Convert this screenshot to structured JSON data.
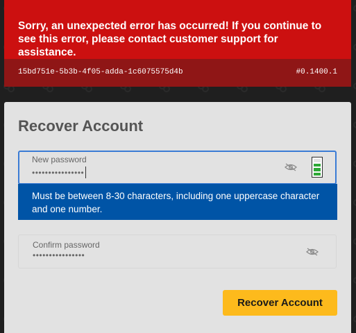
{
  "error": {
    "message": "Sorry, an unexpected error has occurred! If you continue to see this error, please contact customer support for assistance.",
    "error_id": "15bd751e-5b3b-4f05-adda-1c6075575d4b",
    "version": "#0.1400.1",
    "banner_color": "#cc1010",
    "footer_color": "#8f1616"
  },
  "recover": {
    "title": "Recover Account",
    "new_password": {
      "label": "New password",
      "masked_value": "••••••••••••••••",
      "visibility_icon": "eye-slash-icon",
      "strength_level": 0.75
    },
    "hint": "Must be between 8-30 characters, including one uppercase character and one number.",
    "confirm_password": {
      "label": "Confirm password",
      "masked_value": "••••••••••••••••",
      "visibility_icon": "eye-slash-icon"
    },
    "submit_label": "Recover Account",
    "accent_color": "#fdba1c",
    "hint_color": "#0054a6"
  }
}
